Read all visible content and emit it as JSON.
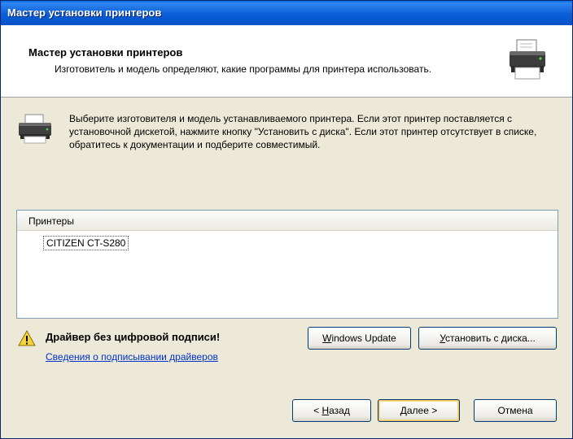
{
  "window": {
    "title": "Мастер установки принтеров"
  },
  "header": {
    "title": "Мастер установки принтеров",
    "subtitle": "Изготовитель и модель определяют, какие программы для принтера использовать."
  },
  "description": "Выберите изготовителя и модель устанавливаемого принтера. Если этот принтер поставляется с установочной дискетой, нажмите кнопку \"Установить с диска\". Если этот принтер отсутствует в списке, обратитесь к документации и подберите совместимый.",
  "printers": {
    "header": "Принтеры",
    "items": [
      "CITIZEN CT-S280"
    ]
  },
  "warning": {
    "text": "Драйвер без цифровой подписи!",
    "link": "Сведения о подписывании драйверов"
  },
  "buttons": {
    "wu_first": "W",
    "wu_rest": "indows Update",
    "disk_first": "У",
    "disk_rest": "становить с диска...",
    "back_pre": "< ",
    "back_key": "Н",
    "back_rest": "азад",
    "next_key": "Д",
    "next_rest": "алее >",
    "cancel": "Отмена"
  },
  "icons": {
    "header": "printer-icon",
    "description": "printer-icon",
    "warning": "warning-icon"
  }
}
